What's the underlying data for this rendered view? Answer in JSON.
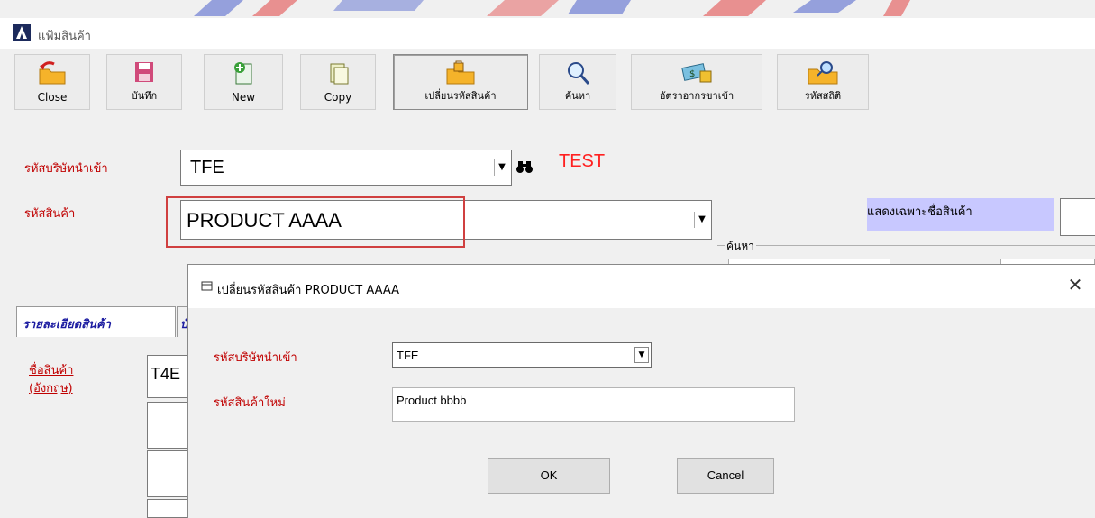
{
  "window": {
    "title": "แฟ้มสินค้า"
  },
  "toolbar": {
    "buttons": [
      {
        "label": "Close",
        "icon": "folder-open-arrow-icon"
      },
      {
        "label": "บันทึก",
        "icon": "save-disk-icon"
      },
      {
        "label": "New",
        "icon": "new-document-icon"
      },
      {
        "label": "Copy",
        "icon": "copy-document-icon"
      },
      {
        "label": "เปลี่ยนรหัสสินค้า",
        "icon": "folder-lock-icon"
      },
      {
        "label": "ค้นหา",
        "icon": "magnifier-icon"
      },
      {
        "label": "อัตราอากรขาเข้า",
        "icon": "money-icon"
      },
      {
        "label": "รหัสสถิติ",
        "icon": "folder-search-icon"
      }
    ]
  },
  "form": {
    "importer_label": "รหัสบริษัทนำเข้า",
    "importer_value": "TFE",
    "company_name": "TEST",
    "product_label": "รหัสสินค้า",
    "product_value": "PRODUCT AAAA",
    "filter_label": "แสดงเฉพาะชื่อสินค้า",
    "search_legend": "ค้นหา",
    "tabs": [
      {
        "label": "รายละเอียดสินค้า"
      },
      {
        "label": "บั"
      }
    ],
    "name_label_line1": "ชื่อสินค้า",
    "name_label_line2": "(อังกฤษ)",
    "name_value": "T4E"
  },
  "dialog": {
    "title": "เปลี่ยนรหัสสินค้า PRODUCT AAAA",
    "importer_label": "รหัสบริษัทนำเข้า",
    "importer_value": "TFE",
    "new_code_label": "รหัสสินค้าใหม่",
    "new_code_value": "Product bbbb",
    "ok_label": "OK",
    "cancel_label": "Cancel",
    "close_glyph": "✕"
  },
  "colors": {
    "label_red": "#c00000",
    "company_red": "#ff2020",
    "filter_bg": "#c8c8ff",
    "highlight_frame": "#d04040"
  }
}
